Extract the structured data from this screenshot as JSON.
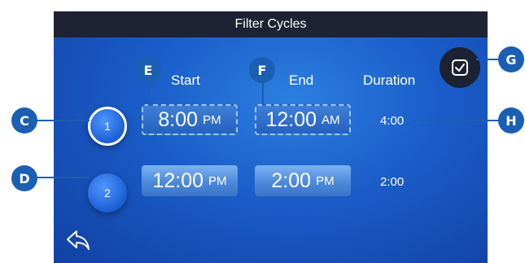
{
  "title": "Filter Cycles",
  "columns": {
    "start": "Start",
    "end": "End",
    "duration": "Duration"
  },
  "cycles": [
    {
      "number": "1",
      "start_time": "8:00",
      "start_ampm": "PM",
      "end_time": "12:00",
      "end_ampm": "AM",
      "duration": "4:00",
      "selected": true
    },
    {
      "number": "2",
      "start_time": "12:00",
      "start_ampm": "PM",
      "end_time": "2:00",
      "end_ampm": "PM",
      "duration": "2:00",
      "selected": false
    }
  ],
  "callouts": {
    "c": "C",
    "d": "D",
    "e": "E",
    "f": "F",
    "g": "G",
    "h": "H"
  },
  "icons": {
    "confirm": "checkbox-check-icon",
    "back": "back-arrow-icon"
  },
  "colors": {
    "callout": "#1b5fb3",
    "titlebar": "#1e2233",
    "screen": "#1a5cc8"
  }
}
